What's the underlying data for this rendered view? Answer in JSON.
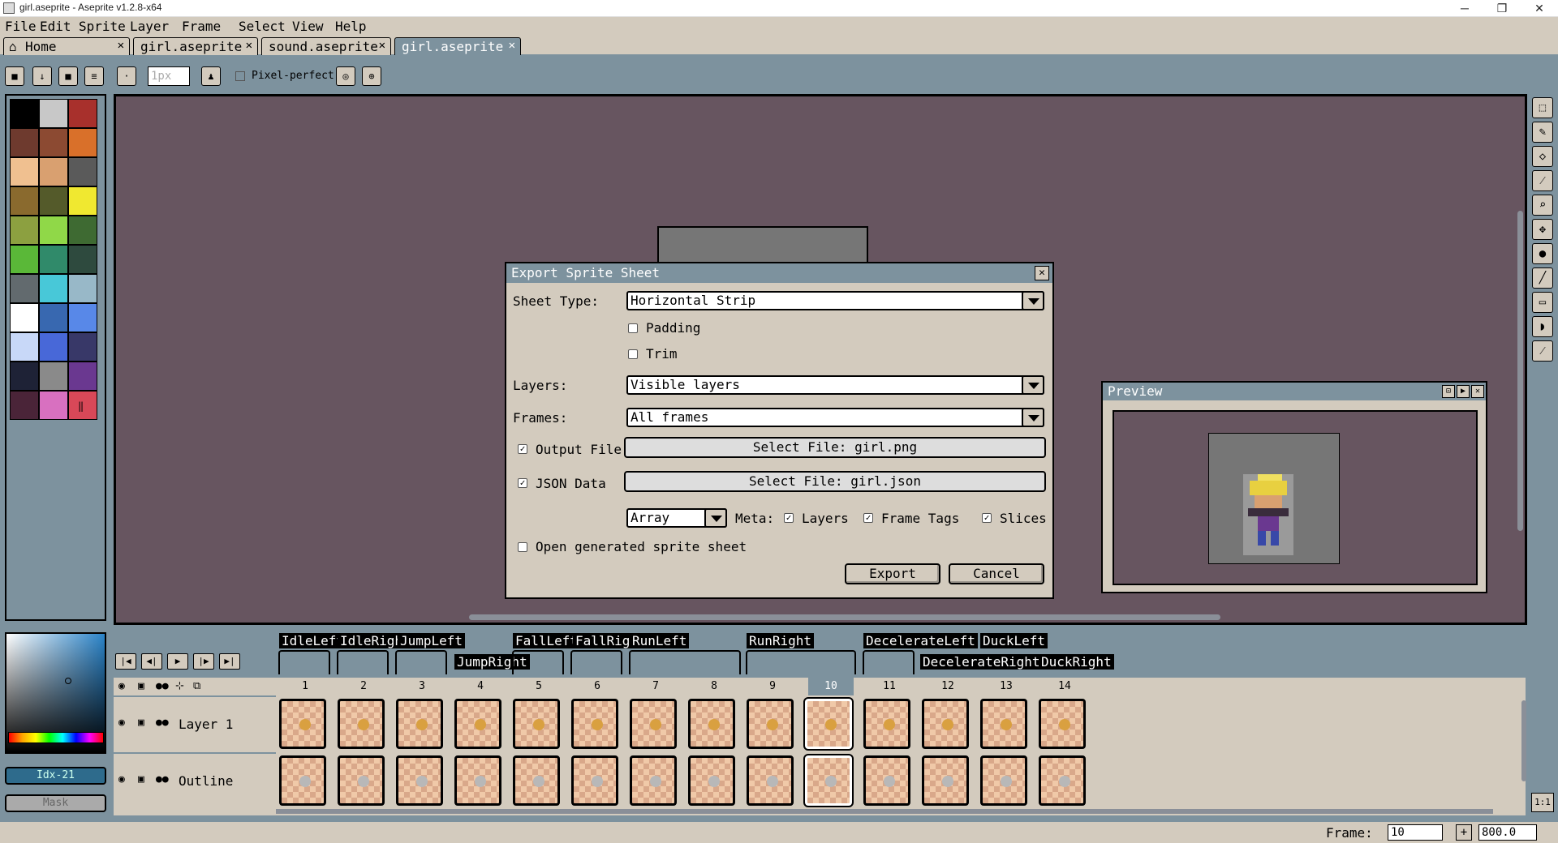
{
  "window": {
    "title": "girl.aseprite - Aseprite v1.2.8-x64",
    "minimize": "─",
    "maximize": "❐",
    "close": "✕"
  },
  "menu": [
    "File",
    "Edit",
    "Sprite",
    "Layer",
    "Frame",
    "Select",
    "View",
    "Help"
  ],
  "tabs": [
    {
      "label": "Home",
      "close": "✕"
    },
    {
      "label": "girl.aseprite",
      "close": "✕"
    },
    {
      "label": "sound.aseprite",
      "close": "✕"
    },
    {
      "label": "girl.aseprite",
      "close": "✕"
    }
  ],
  "contextbar": {
    "brush_size": "1px",
    "pixel_perfect_label": "Pixel-perfect"
  },
  "palette": {
    "colors": [
      "#000000",
      "#c8c8c8",
      "#a8302c",
      "#6e3a2e",
      "#8c4a32",
      "#d9702a",
      "#f0c090",
      "#d9a070",
      "#5a5a5a",
      "#8a6a2e",
      "#545a2a",
      "#f0e830",
      "#8ca040",
      "#90d848",
      "#3e6a32",
      "#5ab838",
      "#308a6a",
      "#2e4a3e",
      "#626a6e",
      "#48c8d8",
      "#98b8c8",
      "#ffffff",
      "#3868b0",
      "#5888e8",
      "#c8d8f8",
      "#4868d8",
      "#383868",
      "#1e2236",
      "#8a8a8a",
      "#6a3890",
      "#4a2438",
      "#d870c0",
      "#d84858"
    ],
    "extra_icon": "resize-handle"
  },
  "colorbar": {
    "index_label": "Idx-21",
    "mask_label": "Mask"
  },
  "dialog": {
    "title": "Export Sprite Sheet",
    "close": "✕",
    "sheet_type_label": "Sheet Type:",
    "sheet_type_value": "Horizontal Strip",
    "padding_label": "Padding",
    "trim_label": "Trim",
    "layers_label": "Layers:",
    "layers_value": "Visible layers",
    "frames_label": "Frames:",
    "frames_value": "All frames",
    "output_file_label": "Output File",
    "output_file_button": "Select File: girl.png",
    "json_label": "JSON Data",
    "json_button": "Select File: girl.json",
    "json_format": "Array",
    "meta_label": "Meta:",
    "meta_layers": "Layers",
    "meta_frame_tags": "Frame Tags",
    "meta_slices": "Slices",
    "open_generated_label": "Open generated sprite sheet",
    "export_button": "Export",
    "cancel_button": "Cancel"
  },
  "preview": {
    "title": "Preview"
  },
  "timeline": {
    "tags": [
      {
        "label": "IdleLeft"
      },
      {
        "label": "IdleRight"
      },
      {
        "label": "JumpLeft"
      },
      {
        "label": "JumpRight"
      },
      {
        "label": "FallLeft"
      },
      {
        "label": "FallRight"
      },
      {
        "label": "RunLeft"
      },
      {
        "label": "RunRight"
      },
      {
        "label": "DecelerateLeft"
      },
      {
        "label": "DecelerateRight"
      },
      {
        "label": "DuckLeft"
      },
      {
        "label": "DuckRight"
      }
    ],
    "frames": [
      "1",
      "2",
      "3",
      "4",
      "5",
      "6",
      "7",
      "8",
      "9",
      "10",
      "11",
      "12",
      "13",
      "14"
    ],
    "current_frame_index": 9,
    "layers": [
      {
        "name": "Layer 1"
      },
      {
        "name": "Outline"
      }
    ]
  },
  "status": {
    "frame_label": "Frame:",
    "frame_value": "10",
    "zoom_value": "800.0",
    "add_frame": "+",
    "one_to_one": "1:1"
  }
}
